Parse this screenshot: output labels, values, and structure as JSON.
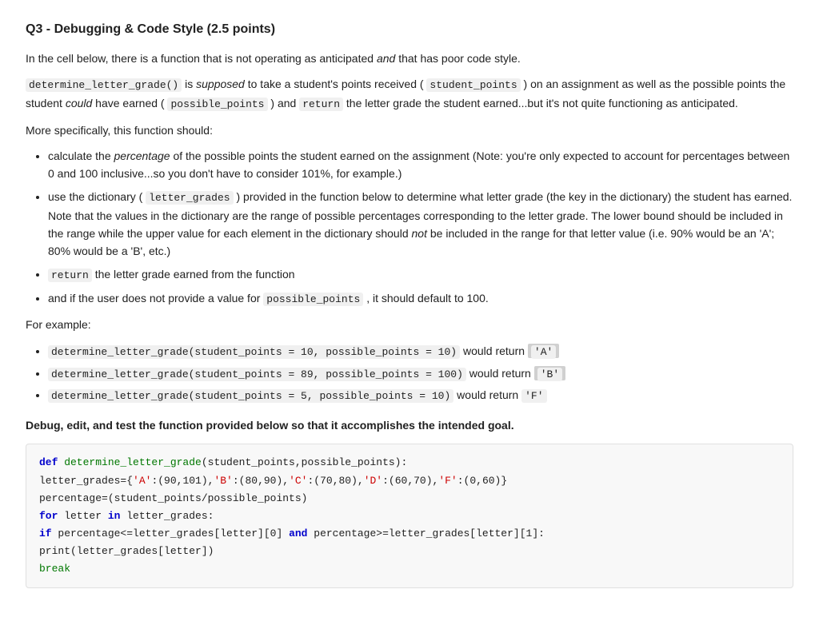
{
  "title": "Q3 - Debugging & Code Style (2.5 points)",
  "intro": {
    "p1": "In the cell below, there is a function that is not operating as anticipated ",
    "p1_italic": "and",
    "p1_end": " that has poor code style.",
    "p2_start": " is ",
    "p2_italic": "supposed",
    "p2_end": " to take a student's points received ( ",
    "p2_code1": "determine_letter_grade()",
    "p2_code2": "student_points",
    "p2_mid": " ) on an assignment as well as the possible points the student ",
    "p2_italic2": "could",
    "p2_mid2": " have earned ( ",
    "p2_code3": "possible_points",
    "p2_mid3": " ) and ",
    "p2_code4": "return",
    "p2_end2": " the letter grade the student earned...but it's not quite functioning as anticipated."
  },
  "more_specifically": "More specifically, this function should:",
  "bullets": [
    {
      "text_before": "calculate the ",
      "italic": "percentage",
      "text_after": " of the possible points the student earned on the assignment (Note: you're only expected to account for percentages between 0 and 100 inclusive...so you don't have to consider 101%, for example.)"
    },
    {
      "text_before": "use the dictionary ( ",
      "code": "letter_grades",
      "text_after": " ) provided in the function below to determine what letter grade (the key in the dictionary) the student has earned. Note that the values in the dictionary are the range of possible percentages corresponding to the letter grade. The lower bound should be included in the range while the upper value for each element in the dictionary should ",
      "italic": "not",
      "text_end": " be included in the range for that letter value (i.e. 90% would be an 'A'; 80% would be a 'B', etc.)"
    },
    {
      "code": "return",
      "text_after": " the letter grade earned from the function"
    },
    {
      "text_before": "and if the user does not provide a value for ",
      "code": "possible_points",
      "text_after": " , it should default to 100."
    }
  ],
  "for_example": "For example:",
  "examples": [
    {
      "code": "determine_letter_grade(student_points = 10, possible_points = 10)",
      "word": " would return ",
      "result": "'A'"
    },
    {
      "code": "determine_letter_grade(student_points = 89, possible_points = 100)",
      "word": " would return ",
      "result": "'B'"
    },
    {
      "code": "determine_letter_grade(student_points = 5, possible_points = 10)",
      "word": " would return ",
      "result": "'F'"
    }
  ],
  "debug_instruction": "Debug, edit, and test the function provided below so that it accomplishes the intended goal.",
  "code": {
    "line1_kw": "def",
    "line1_fn": " determine_letter_grade",
    "line1_params": "(student_points,possible_points):",
    "line2": "    letter_grades={'A':(90,101),'B':(80,90),'C':(70,80),'D':(60,70),'F':(0,60)}",
    "line3": "    percentage=(student_points/possible_points)",
    "line4_kw": "    for",
    "line4_rest": " letter ",
    "line4_kw2": "in",
    "line4_rest2": " letter_grades:",
    "line5_kw": "        if",
    "line5_rest": " percentage<=letter_grades[letter][0] ",
    "line5_kw2": "and",
    "line5_rest2": " percentage>=letter_grades[letter][1]:",
    "line6": "            print(letter_grades[letter])",
    "line7_kw": "        break"
  }
}
